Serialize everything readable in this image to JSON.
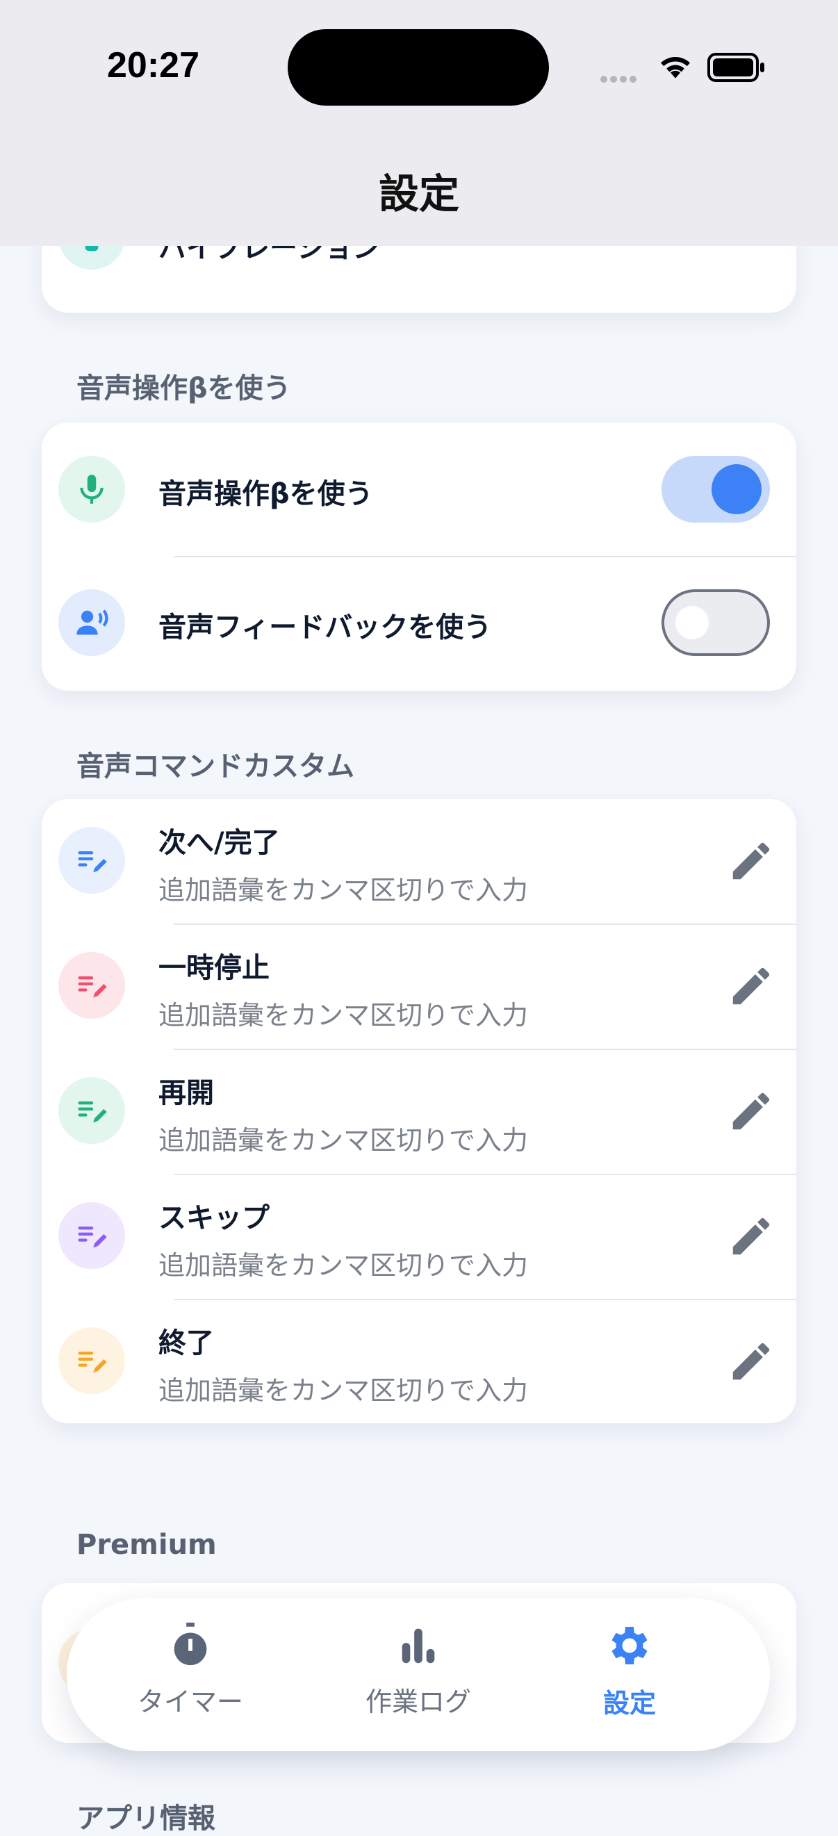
{
  "status_bar": {
    "time": "20:27"
  },
  "nav": {
    "title": "設定"
  },
  "vibration_card": {
    "label": "バイブレーション"
  },
  "voice_section": {
    "header": "音声操作βを使う",
    "rows": [
      {
        "label": "音声操作βを使う",
        "toggle_state": "on"
      },
      {
        "label": "音声フィードバックを使う",
        "toggle_state": "off"
      }
    ]
  },
  "commands_section": {
    "header": "音声コマンドカスタム",
    "rows": [
      {
        "title": "次へ/完了",
        "placeholder": "追加語彙をカンマ区切りで入力",
        "accent": "#3b82f6",
        "bg": "#e8effd"
      },
      {
        "title": "一時停止",
        "placeholder": "追加語彙をカンマ区切りで入力",
        "accent": "#f0506e",
        "bg": "#fde6ea"
      },
      {
        "title": "再開",
        "placeholder": "追加語彙をカンマ区切りで入力",
        "accent": "#22b07d",
        "bg": "#e2f6ee"
      },
      {
        "title": "スキップ",
        "placeholder": "追加語彙をカンマ区切りで入力",
        "accent": "#8b5cf6",
        "bg": "#efe7fd"
      },
      {
        "title": "終了",
        "placeholder": "追加語彙をカンマ区切りで入力",
        "accent": "#f5a524",
        "bg": "#fef3e0"
      }
    ]
  },
  "premium_section": {
    "header": "Premium"
  },
  "app_info_section": {
    "header": "アプリ情報"
  },
  "tab_bar": {
    "tabs": [
      {
        "label": "タイマー",
        "icon": "stopwatch-icon",
        "active": false
      },
      {
        "label": "作業ログ",
        "icon": "bar-chart-icon",
        "active": false
      },
      {
        "label": "設定",
        "icon": "gear-icon",
        "active": true
      }
    ]
  },
  "colors": {
    "accent": "#3b82f6",
    "toggle_track_on": "#c7d9fb",
    "background": "#f3f6fb"
  }
}
